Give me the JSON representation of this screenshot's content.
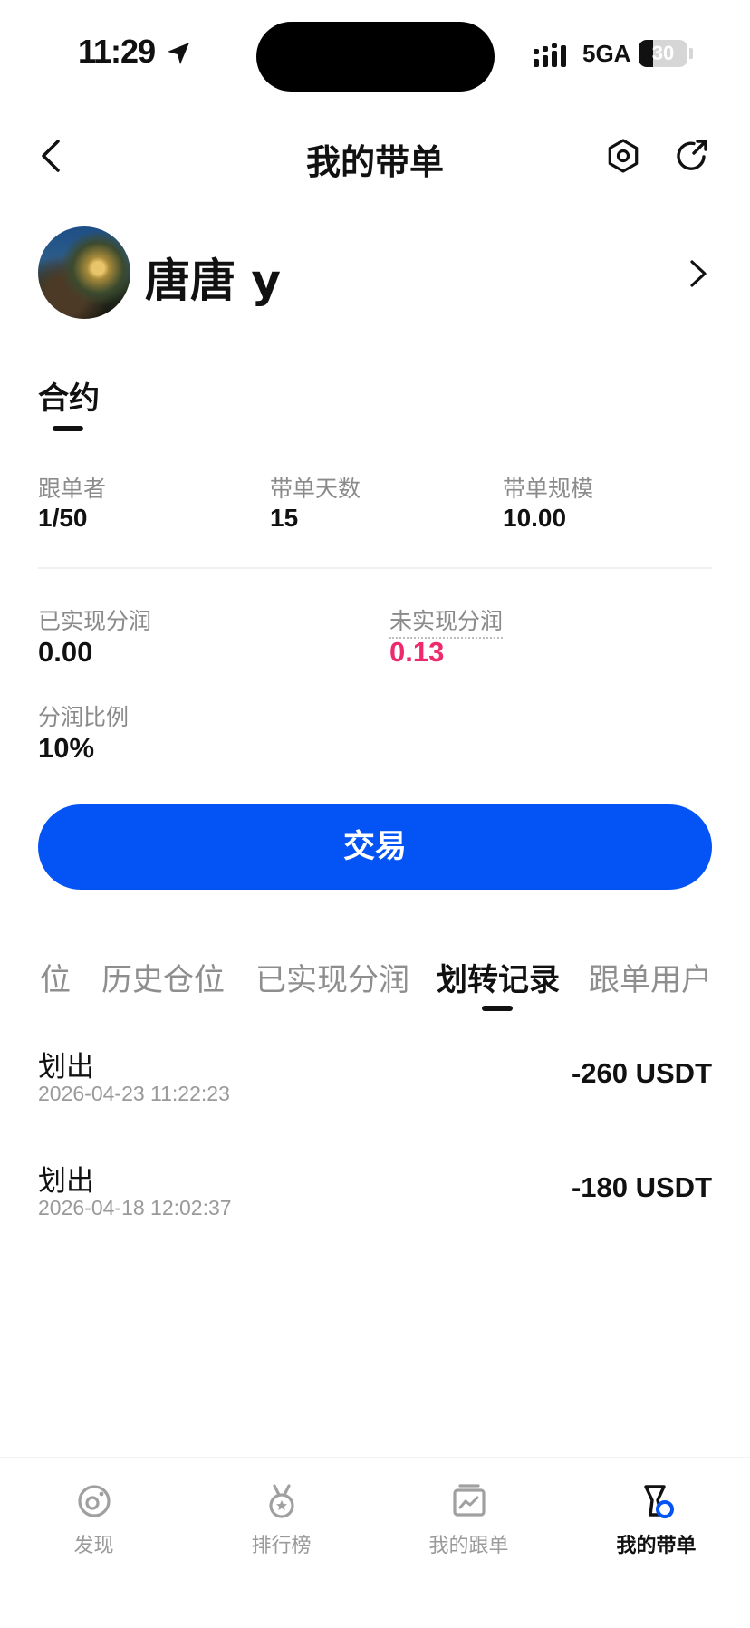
{
  "status_bar": {
    "time": "11:29",
    "network": "5GA",
    "battery": "30",
    "battery_level": 0.3
  },
  "header": {
    "title": "我的带单"
  },
  "profile": {
    "name": "唐唐 y"
  },
  "contract_tab": {
    "label": "合约"
  },
  "stats": [
    {
      "label": "跟单者",
      "value": "1/50"
    },
    {
      "label": "带单天数",
      "value": "15"
    },
    {
      "label": "带单规模",
      "value": "10.00"
    }
  ],
  "pnl": {
    "realized": {
      "label": "已实现分润",
      "value": "0.00"
    },
    "unrealized": {
      "label": "未实现分润",
      "value": "0.13",
      "color": "#ee2a6a"
    },
    "ratio": {
      "label": "分润比例",
      "value": "10%"
    }
  },
  "trade_button": {
    "label": "交易",
    "color": "#0454f5"
  },
  "tabs": [
    {
      "label": "位",
      "active": false
    },
    {
      "label": "历史仓位",
      "active": false
    },
    {
      "label": "已实现分润",
      "active": false
    },
    {
      "label": "划转记录",
      "active": true
    },
    {
      "label": "跟单用户",
      "active": false
    }
  ],
  "records": [
    {
      "type": "划出",
      "time": "2026-04-23 11:22:23",
      "amount": "-260 USDT"
    },
    {
      "type": "划出",
      "time": "2026-04-18 12:02:37",
      "amount": "-180 USDT"
    }
  ],
  "bottom_nav": [
    {
      "label": "发现",
      "icon": "discover-icon",
      "active": false
    },
    {
      "label": "排行榜",
      "icon": "medal-icon",
      "active": false
    },
    {
      "label": "我的跟单",
      "icon": "chart-card-icon",
      "active": false
    },
    {
      "label": "我的带单",
      "icon": "lead-trade-icon",
      "active": true
    }
  ]
}
